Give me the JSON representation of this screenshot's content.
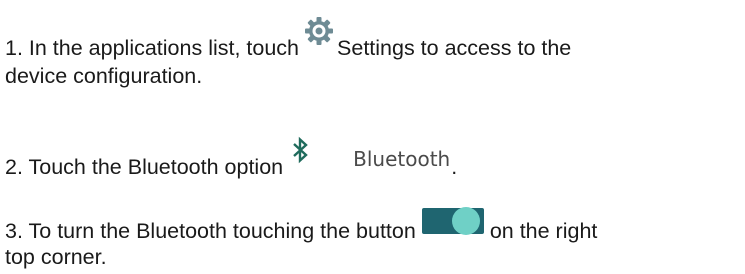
{
  "steps": [
    {
      "line1_before": "1. In the applications list, touch",
      "icon": "settings-gear-icon",
      "line1_after": "Settings to access to the",
      "line2": "device configuration."
    },
    {
      "text_before": "2.  Touch the Bluetooth option",
      "icon": "bluetooth-icon",
      "option_label": "Bluetooth",
      "text_after": "."
    },
    {
      "line1_before": "3. To turn the Bluetooth touching the button",
      "icon": "toggle-switch-on-icon",
      "line1_after": "on the right",
      "line2": "top corner."
    }
  ],
  "colors": {
    "text": "#1a1a1a",
    "gear": "#6e8b94",
    "bluetooth": "#1f6b5c",
    "toggle_track": "#1f6570",
    "toggle_knob": "#6fd0c6",
    "option_label": "#4a4a4a"
  }
}
